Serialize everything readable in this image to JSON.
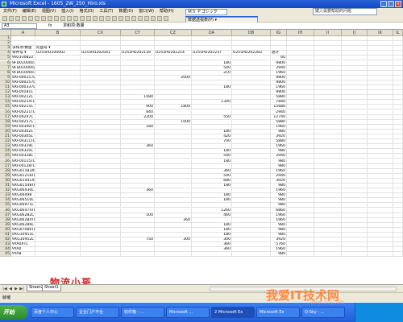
{
  "window": {
    "title": "Microsoft Excel - 1605_2W_250_Hiro.xls",
    "buttons": [
      "_",
      "□",
      "×"
    ]
  },
  "menu": [
    "文件(F)",
    "编辑(E)",
    "视图(V)",
    "插入(I)",
    "格式(O)",
    "工具(T)",
    "数据(D)",
    "窗口(W)",
    "帮助(H)"
  ],
  "font_box": "ＭＳ Ｐゴシック",
  "pivot_toolbar": {
    "label": "数据透视表(P) ▾"
  },
  "help_box": "键入需要帮助的问题",
  "name_box": "A3",
  "formula": {
    "fx": "fx",
    "content": "求和项:数量"
  },
  "columns": [
    "A",
    "B",
    "CX",
    "CY",
    "CZ",
    "DA",
    "DB",
    "IG",
    "IH",
    "II",
    "IJ",
    "IK",
    "IL"
  ],
  "header_rows": [
    {
      "n": "1",
      "cells": [
        "",
        "",
        "",
        "",
        "",
        "",
        "",
        ""
      ]
    },
    {
      "n": "2",
      "cells": [
        "",
        "",
        "",
        "",
        "",
        "",
        "",
        ""
      ]
    },
    {
      "n": "3",
      "cells": [
        "求和项:数量",
        "托盘号 ▾",
        "",
        "",
        "",
        "",
        "",
        ""
      ]
    },
    {
      "n": "4",
      "cells": [
        "零件号 ▾",
        "U255PD100002",
        "U255PD202041",
        "U255PD202139",
        "U255PD202214",
        "U255PD202237",
        "U255PD202283",
        "总计"
      ]
    }
  ],
  "rows": [
    {
      "n": "5",
      "a": "992330822",
      "cy": "",
      "cz": "",
      "da": "",
      "db": "",
      "ig": "60"
    },
    {
      "n": "6",
      "a": "9FD0100001",
      "cy": "",
      "cz": "",
      "da": "180",
      "db": "",
      "ig": "9800"
    },
    {
      "n": "7",
      "a": "9FD0100002",
      "cy": "",
      "cz": "",
      "da": "540",
      "db": "",
      "ig": "2940"
    },
    {
      "n": "8",
      "a": "9FD0100003",
      "cy": "",
      "cz": "",
      "da": "210",
      "db": "",
      "ig": "1960"
    },
    {
      "n": "9",
      "a": "9XF000157L",
      "cy": "",
      "cz": "2000",
      "da": "",
      "db": "",
      "ig": "9800"
    },
    {
      "n": "10",
      "a": "9XF000257L",
      "cy": "",
      "cz": "",
      "da": "",
      "db": "",
      "ig": "9800"
    },
    {
      "n": "11",
      "a": "9XF000337L",
      "cy": "",
      "cz": "",
      "da": "180",
      "db": "",
      "ig": "1960"
    },
    {
      "n": "12",
      "a": "9XF00181L",
      "cy": "",
      "cz": "",
      "da": "",
      "db": "",
      "ig": "9800"
    },
    {
      "n": "13",
      "a": "9XF00212L",
      "cy": "1080",
      "cz": "",
      "da": "",
      "db": "",
      "ig": "5880"
    },
    {
      "n": "14",
      "a": "9XF00214TL",
      "cy": "",
      "cz": "",
      "da": "1340",
      "db": "",
      "ig": "7840"
    },
    {
      "n": "15",
      "a": "9XF00215L",
      "cy": "900",
      "cz": "1800",
      "da": "",
      "db": "",
      "ig": "15680"
    },
    {
      "n": "16",
      "a": "9XF00221TL",
      "cy": "840",
      "cz": "",
      "da": "",
      "db": "",
      "ig": "2940"
    },
    {
      "n": "17",
      "a": "9XF00247L",
      "cy": "2200",
      "cz": "",
      "da": "550",
      "db": "",
      "ig": "12740"
    },
    {
      "n": "18",
      "a": "9XF00257L",
      "cy": "",
      "cz": "1000",
      "da": "",
      "db": "",
      "ig": "5880"
    },
    {
      "n": "19",
      "a": "9XF00300TL",
      "cy": "180",
      "cz": "",
      "da": "",
      "db": "",
      "ig": "1960"
    },
    {
      "n": "20",
      "a": "9XF00302L",
      "cy": "",
      "cz": "",
      "da": "180",
      "db": "",
      "ig": "980"
    },
    {
      "n": "21",
      "a": "9XF00305L",
      "cy": "",
      "cz": "",
      "da": "420",
      "db": "",
      "ig": "3920"
    },
    {
      "n": "22",
      "a": "9XF00311TL",
      "cy": "",
      "cz": "",
      "da": "700",
      "db": "",
      "ig": "5880"
    },
    {
      "n": "23",
      "a": "9XF00319L",
      "cy": "360",
      "cz": "",
      "da": "",
      "db": "",
      "ig": "1960"
    },
    {
      "n": "24",
      "a": "9XF00320L",
      "cy": "",
      "cz": "",
      "da": "180",
      "db": "",
      "ig": "980"
    },
    {
      "n": "25",
      "a": "9XF00328L",
      "cy": "",
      "cz": "",
      "da": "540",
      "db": "",
      "ig": "2940"
    },
    {
      "n": "26",
      "a": "9XF00115TL",
      "cy": "",
      "cz": "",
      "da": "180",
      "db": "",
      "ig": "980"
    },
    {
      "n": "27",
      "a": "9XF00128TL",
      "cy": "",
      "cz": "",
      "da": "",
      "db": "",
      "ig": "980"
    },
    {
      "n": "28",
      "a": "9XG01183X0",
      "cy": "",
      "cz": "",
      "da": "360",
      "db": "",
      "ig": "1960"
    },
    {
      "n": "29",
      "a": "9XG01218TL",
      "cy": "",
      "cz": "",
      "da": "540",
      "db": "",
      "ig": "2940"
    },
    {
      "n": "30",
      "a": "9XG01441X0",
      "cy": "",
      "cz": "",
      "da": "680",
      "db": "",
      "ig": "3920"
    },
    {
      "n": "31",
      "a": "9XG01548TL",
      "cy": "",
      "cz": "",
      "da": "180",
      "db": "",
      "ig": "980"
    },
    {
      "n": "32",
      "a": "9XG06430L",
      "cy": "360",
      "cz": "",
      "da": "",
      "db": "",
      "ig": "1960"
    },
    {
      "n": "33",
      "a": "9XG06498",
      "cy": "",
      "cz": "",
      "da": "180",
      "db": "",
      "ig": "980"
    },
    {
      "n": "34",
      "a": "9XG06510L",
      "cy": "",
      "cz": "",
      "da": "180",
      "db": "",
      "ig": "980"
    },
    {
      "n": "35",
      "a": "9XG06971L",
      "cy": "",
      "cz": "",
      "da": "",
      "db": "",
      "ig": "980"
    },
    {
      "n": "36",
      "a": "9XG06474TL",
      "cy": "",
      "cz": "",
      "da": "1260",
      "db": "",
      "ig": "6860"
    },
    {
      "n": "37",
      "a": "9XG06282L",
      "cy": "500",
      "cz": "",
      "da": "460",
      "db": "",
      "ig": "1960"
    },
    {
      "n": "38",
      "a": "9XG06284TL",
      "cy": "",
      "cz": "360",
      "da": "",
      "db": "",
      "ig": "1960"
    },
    {
      "n": "39",
      "a": "9XG06286L",
      "cy": "",
      "cz": "",
      "da": "180",
      "db": "",
      "ig": "980"
    },
    {
      "n": "40",
      "a": "9XG07086TL",
      "cy": "",
      "cz": "",
      "da": "180",
      "db": "",
      "ig": "980"
    },
    {
      "n": "41",
      "a": "9XG10951L",
      "cy": "",
      "cz": "",
      "da": "180",
      "db": "",
      "ig": "980"
    },
    {
      "n": "42",
      "a": "9XG10952L",
      "cy": "750",
      "cz": "300",
      "da": "300",
      "db": "",
      "ig": "3920"
    },
    {
      "n": "43",
      "a": "9YA0XTL",
      "cy": "",
      "cz": "",
      "da": "360",
      "db": "",
      "ig": "5760"
    },
    {
      "n": "44",
      "a": "9YA0",
      "cy": "",
      "cz": "",
      "da": "360",
      "db": "",
      "ig": "1960"
    },
    {
      "n": "45",
      "a": "9YA8",
      "cy": "",
      "cz": "",
      "da": "",
      "db": "",
      "ig": "980"
    }
  ],
  "sheet_nav": [
    "|◀",
    "◀",
    "▶",
    "▶|"
  ],
  "sheets": [
    "Sheet2",
    "Sheet1"
  ],
  "status": "就绪",
  "start_label": "开始",
  "tasks": [
    "百度个人中心",
    "企业门户平台",
    "收件箱 - ...",
    "Microsoft ...",
    "2 Microsoft Ex",
    "Microsoft Ex",
    "Q-Sky - ..."
  ],
  "watermark_text": "物流小哥",
  "site_watermark": "我爱IT技术网",
  "site_watermark_url": "www.52ij.com"
}
